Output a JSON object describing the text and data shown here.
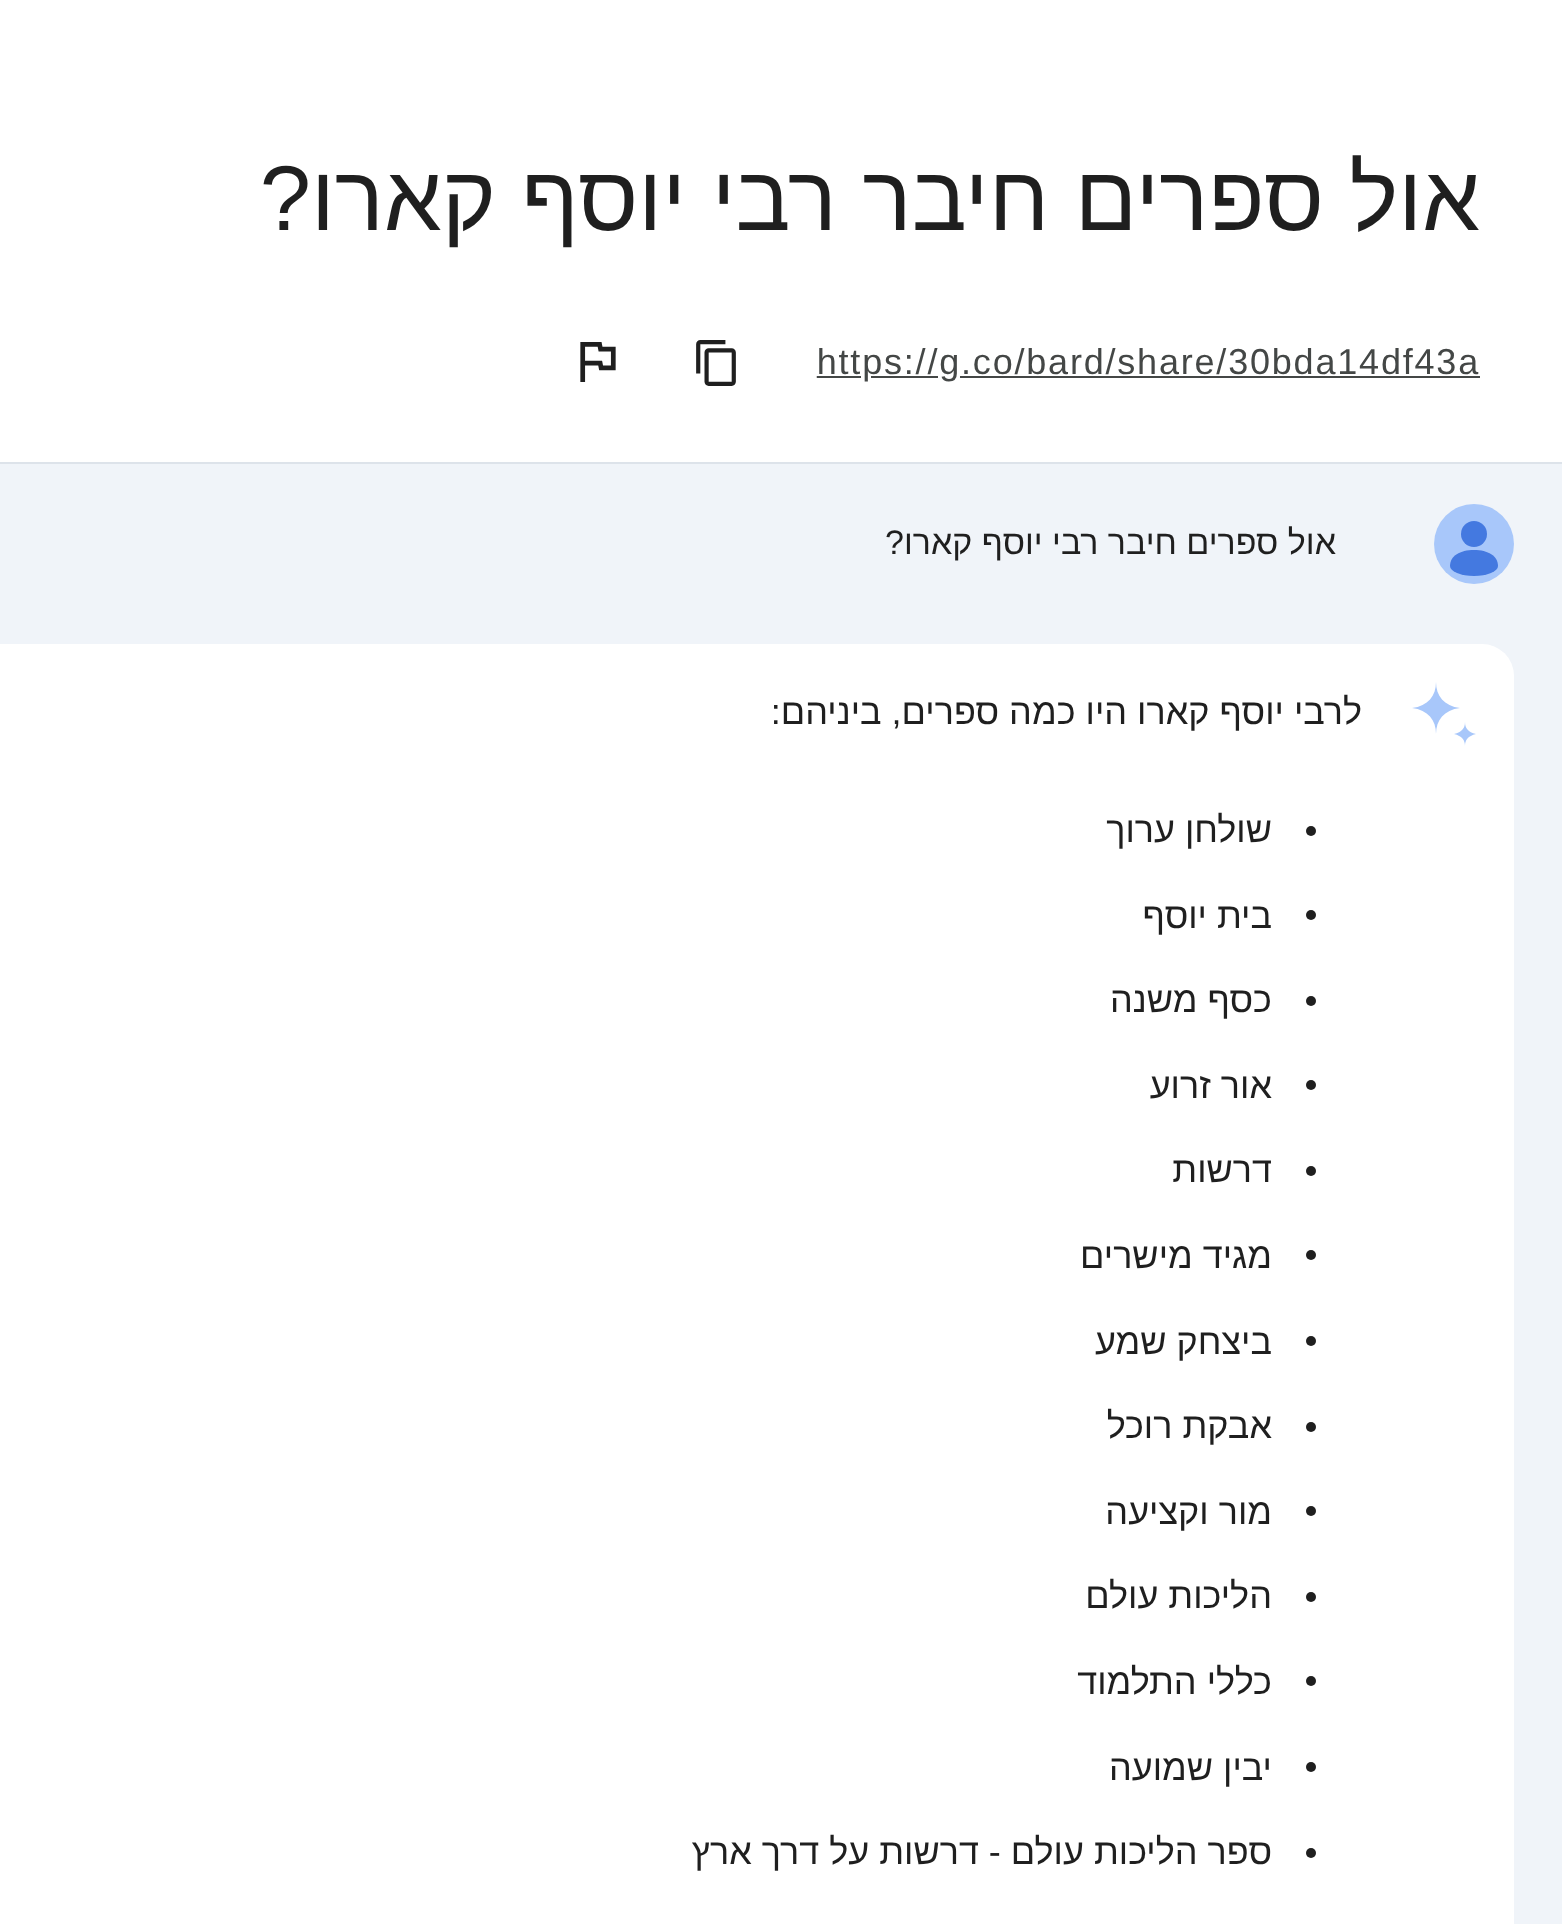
{
  "title": "אול ספרים חיבר רבי יוסף קארו?",
  "share": {
    "link": "https://g.co/bard/share/30bda14df43a"
  },
  "prompt": {
    "text": "אול ספרים חיבר רבי יוסף קארו?"
  },
  "response": {
    "intro": "לרבי יוסף קארו היו כמה ספרים, ביניהם:",
    "items": [
      "שולחן ערוך",
      "בית יוסף",
      "כסף משנה",
      "אור זרוע",
      "דרשות",
      "מגיד מישרים",
      "ביצחק שמע",
      "אבקת רוכל",
      "מור וקציעה",
      "הליכות עולם",
      "כללי התלמוד",
      "יבין שמועה",
      "ספר הליכות עולם - דרשות על דרך ארץ"
    ]
  }
}
